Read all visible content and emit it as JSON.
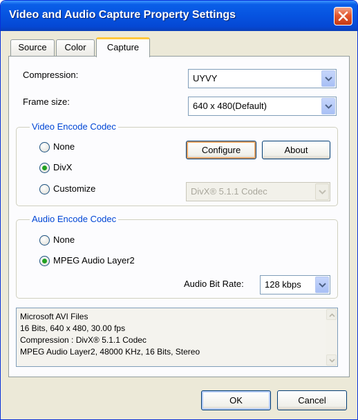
{
  "window": {
    "title": "Video and Audio Capture Property Settings"
  },
  "tabs": [
    {
      "label": "Source",
      "active": false
    },
    {
      "label": "Color",
      "active": false
    },
    {
      "label": "Capture",
      "active": true
    }
  ],
  "compression": {
    "label": "Compression:",
    "value": "UYVY"
  },
  "frame_size": {
    "label": "Frame size:",
    "value": "640 x 480(Default)"
  },
  "video_codec": {
    "title": "Video Encode Codec",
    "options": [
      {
        "label": "None",
        "selected": false
      },
      {
        "label": "DivX",
        "selected": true
      },
      {
        "label": "Customize",
        "selected": false
      }
    ],
    "configure_label": "Configure",
    "about_label": "About",
    "codec_value": "DivX® 5.1.1 Codec"
  },
  "audio_codec": {
    "title": "Audio Encode Codec",
    "options": [
      {
        "label": "None",
        "selected": false
      },
      {
        "label": "MPEG Audio Layer2",
        "selected": true
      }
    ],
    "bitrate_label": "Audio Bit Rate:",
    "bitrate_value": "128 kbps"
  },
  "summary": {
    "lines": [
      "Microsoft AVI Files",
      "16 Bits, 640 x 480, 30.00 fps",
      "Compression : DivX® 5.1.1 Codec",
      "MPEG Audio Layer2, 48000 KHz, 16 Bits, Stereo"
    ]
  },
  "footer": {
    "ok_label": "OK",
    "cancel_label": "Cancel"
  },
  "colors": {
    "title_bar": "#0653e0",
    "group_title": "#0046d5",
    "radio_selected": "#21a121",
    "close_button": "#e4572f"
  }
}
